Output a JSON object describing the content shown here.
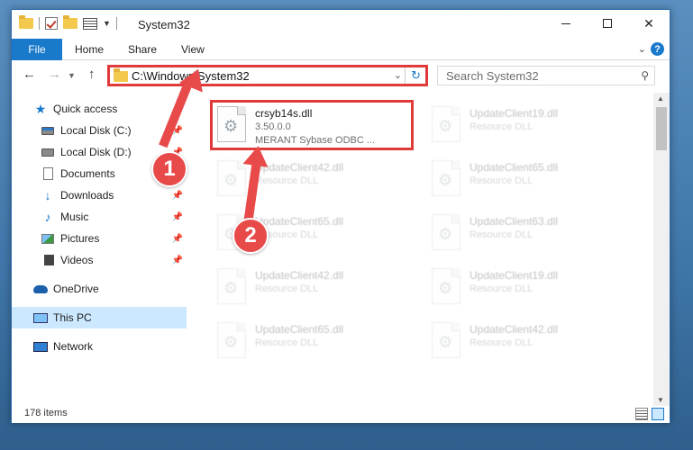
{
  "window": {
    "title": "System32"
  },
  "ribbon": {
    "file": "File",
    "home": "Home",
    "share": "Share",
    "view": "View"
  },
  "address": {
    "path": "C:\\Windows\\System32"
  },
  "search": {
    "placeholder": "Search System32"
  },
  "nav": {
    "items": [
      {
        "label": "Quick access"
      },
      {
        "label": "Local Disk (C:)"
      },
      {
        "label": "Local Disk (D:)"
      },
      {
        "label": "Documents"
      },
      {
        "label": "Downloads"
      },
      {
        "label": "Music"
      },
      {
        "label": "Pictures"
      },
      {
        "label": "Videos"
      },
      {
        "label": "OneDrive"
      },
      {
        "label": "This PC"
      },
      {
        "label": "Network"
      }
    ]
  },
  "files": {
    "highlighted": {
      "name": "crsyb14s.dll",
      "version": "3.50.0.0",
      "description": "MERANT Sybase ODBC ..."
    },
    "others": [
      {
        "name": "UpdateClient19.dll",
        "desc": "Resource DLL"
      },
      {
        "name": "UpdateClient42.dll",
        "desc": "Resource DLL"
      },
      {
        "name": "UpdateClient65.dll",
        "desc": "Resource DLL"
      },
      {
        "name": "UpdateClient65.dll",
        "desc": "Resource DLL"
      },
      {
        "name": "UpdateClient63.dll",
        "desc": "Resource DLL"
      },
      {
        "name": "UpdateClient42.dll",
        "desc": "Resource DLL"
      },
      {
        "name": "UpdateClient19.dll",
        "desc": "Resource DLL"
      },
      {
        "name": "UpdateClient65.dll",
        "desc": "Resource DLL"
      },
      {
        "name": "UpdateClient42.dll",
        "desc": "Resource DLL"
      }
    ]
  },
  "status": {
    "count": "178 items"
  },
  "annotations": {
    "step1": "1",
    "step2": "2",
    "color": "#e84a4a"
  }
}
